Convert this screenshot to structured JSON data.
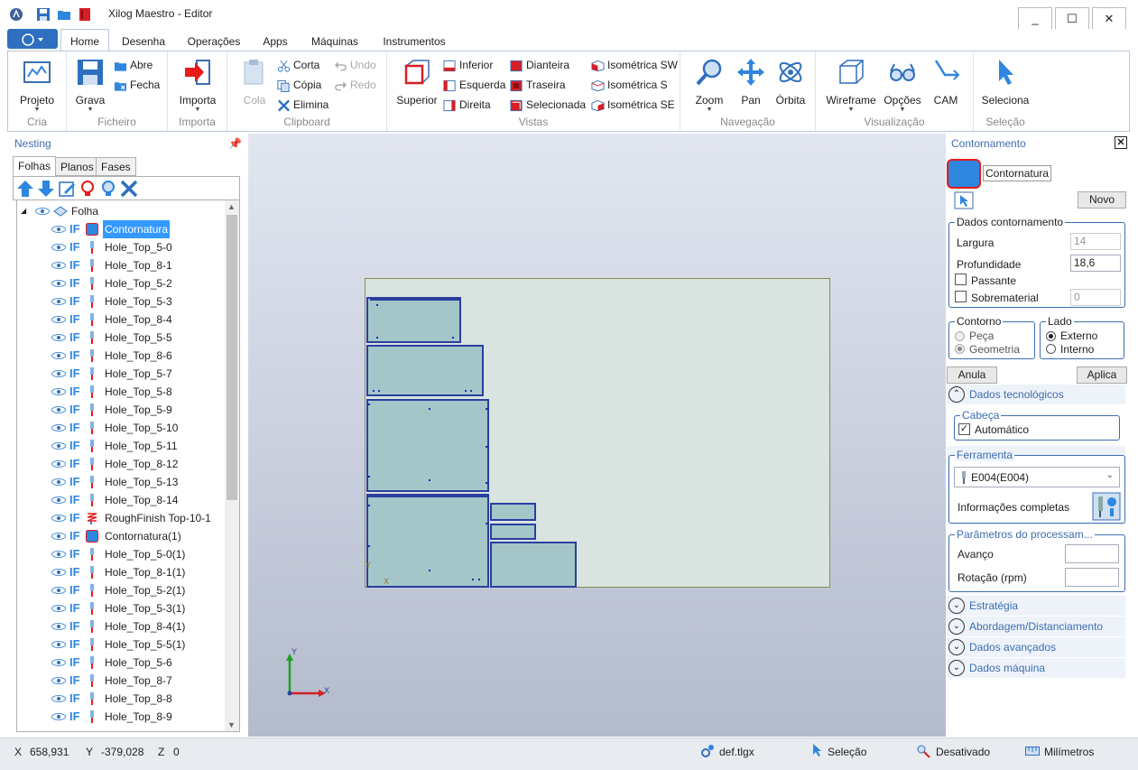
{
  "window": {
    "title": "Xilog Maestro - Editor",
    "minimize": "_",
    "maximize": "☐",
    "close": "✕"
  },
  "ribbon_tabs": [
    "Home",
    "Desenha",
    "Operações",
    "Apps",
    "Máquinas",
    "Instrumentos"
  ],
  "ribbon": {
    "cria": {
      "label": "Cria",
      "projeto": "Projeto"
    },
    "ficheiro": {
      "label": "Ficheiro",
      "grava": "Grava",
      "abre": "Abre",
      "fecha": "Fecha"
    },
    "importa": {
      "label": "Importa",
      "importa": "Importa"
    },
    "clipboard": {
      "label": "Clipboard",
      "cola": "Cola",
      "corta": "Corta",
      "copia": "Cópia",
      "elimina": "Elimina",
      "undo": "Undo",
      "redo": "Redo"
    },
    "vistas": {
      "label": "Vistas",
      "superior": "Superior",
      "inferior": "Inferior",
      "esquerda": "Esquerda",
      "direita": "Direita",
      "dianteira": "Dianteira",
      "traseira": "Traseira",
      "selecionada": "Selecionada",
      "iso_sw": "Isométrica SW",
      "iso_s": "Isométrica S",
      "iso_se": "Isométrica SE"
    },
    "navegacao": {
      "label": "Navegação",
      "zoom": "Zoom",
      "pan": "Pan",
      "orbita": "Órbita"
    },
    "visualizacao": {
      "label": "Visualização",
      "wireframe": "Wireframe",
      "opcoes": "Opções",
      "cam": "CAM"
    },
    "selecao": {
      "label": "Seleção",
      "selecionar": "Seleciona"
    }
  },
  "left_panel": {
    "title": "Nesting",
    "tabs": [
      "Folhas",
      "Planos",
      "Fases"
    ],
    "root": "Folha",
    "items": [
      {
        "label": "Contornatura",
        "icon": "contour",
        "selected": true
      },
      {
        "label": "Hole_Top_5-0",
        "icon": "drill"
      },
      {
        "label": "Hole_Top_8-1",
        "icon": "drill"
      },
      {
        "label": "Hole_Top_5-2",
        "icon": "drill"
      },
      {
        "label": "Hole_Top_5-3",
        "icon": "drill"
      },
      {
        "label": "Hole_Top_8-4",
        "icon": "drill"
      },
      {
        "label": "Hole_Top_5-5",
        "icon": "drill"
      },
      {
        "label": "Hole_Top_8-6",
        "icon": "drill"
      },
      {
        "label": "Hole_Top_5-7",
        "icon": "drill"
      },
      {
        "label": "Hole_Top_5-8",
        "icon": "drill"
      },
      {
        "label": "Hole_Top_5-9",
        "icon": "drill"
      },
      {
        "label": "Hole_Top_5-10",
        "icon": "drill"
      },
      {
        "label": "Hole_Top_5-11",
        "icon": "drill"
      },
      {
        "label": "Hole_Top_8-12",
        "icon": "drill"
      },
      {
        "label": "Hole_Top_5-13",
        "icon": "drill"
      },
      {
        "label": "Hole_Top_8-14",
        "icon": "drill"
      },
      {
        "label": "RoughFinish Top-10-1",
        "icon": "rough"
      },
      {
        "label": "Contornatura(1)",
        "icon": "contour"
      },
      {
        "label": "Hole_Top_5-0(1)",
        "icon": "drill"
      },
      {
        "label": "Hole_Top_8-1(1)",
        "icon": "drill"
      },
      {
        "label": "Hole_Top_5-2(1)",
        "icon": "drill"
      },
      {
        "label": "Hole_Top_5-3(1)",
        "icon": "drill"
      },
      {
        "label": "Hole_Top_8-4(1)",
        "icon": "drill"
      },
      {
        "label": "Hole_Top_5-5(1)",
        "icon": "drill"
      },
      {
        "label": "Hole_Top_5-6",
        "icon": "drill"
      },
      {
        "label": "Hole_Top_8-7",
        "icon": "drill"
      },
      {
        "label": "Hole_Top_8-8",
        "icon": "drill"
      },
      {
        "label": "Hole_Top_8-9",
        "icon": "drill"
      }
    ]
  },
  "canvas": {
    "axis_x": "X",
    "axis_y": "Y",
    "origin_x": "X",
    "origin_y": "Y"
  },
  "right_panel": {
    "title": "Contornamento",
    "name": "Contornatura",
    "novo": "Novo",
    "dados_title": "Dados contornamento",
    "largura_label": "Largura",
    "largura_value": "14",
    "profundidade_label": "Profundidade",
    "profundidade_value": "18,6",
    "passante_label": "Passante",
    "sobrematerial_label": "Sobrematerial",
    "sobrematerial_value": "0",
    "contorno_title": "Contorno",
    "peca": "Peça",
    "geometria": "Geometria",
    "lado_title": "Lado",
    "externo": "Externo",
    "interno": "Interno",
    "anula": "Anula",
    "aplica": "Aplica",
    "dados_tecnologicos": "Dados tecnológicos",
    "cabeca_title": "Cabeça",
    "automatico": "Automático",
    "ferramenta_title": "Ferramenta",
    "ferramenta_value": "E004(E004)",
    "info_completas": "Informações completas",
    "parametros_title": "Parâmetros do processam...",
    "avanco": "Avanço",
    "rotacao": "Rotação (rpm)",
    "estrategia": "Estratégia",
    "abordagem": "Abordagem/Distanciamento",
    "dados_avancados": "Dados avançados",
    "dados_maquina": "Dados máquina"
  },
  "status": {
    "x_label": "X",
    "x_value": "658,931",
    "y_label": "Y",
    "y_value": "-379,028",
    "z_label": "Z",
    "z_value": "0",
    "file": "def.tlgx",
    "mode": "Seleção",
    "state": "Desativado",
    "units": "Milímetros"
  }
}
